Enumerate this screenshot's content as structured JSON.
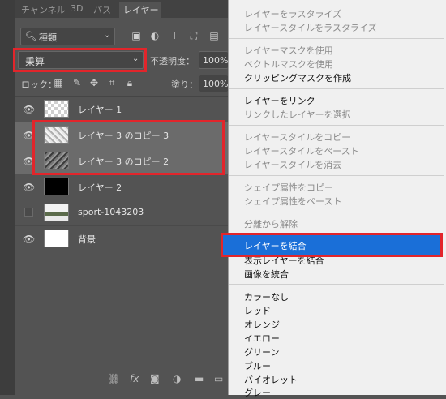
{
  "tabs": [
    "チャンネル",
    "3D",
    "パス",
    "レイヤー"
  ],
  "filter": {
    "label": "種類"
  },
  "blend_mode": "乗算",
  "opacity": {
    "label": "不透明度：",
    "value": "100%"
  },
  "lock": {
    "label": "ロック："
  },
  "fill": {
    "label": "塗り：",
    "value": "100%"
  },
  "layers": [
    {
      "name": "レイヤー 1",
      "visible": true
    },
    {
      "name": "レイヤー 3 のコピー 3",
      "visible": true,
      "selected": true
    },
    {
      "name": "レイヤー 3 のコピー 2",
      "visible": true,
      "selected": true
    },
    {
      "name": "レイヤー 2",
      "visible": true
    },
    {
      "name": "sport-1043203",
      "visible": false
    },
    {
      "name": "背景",
      "visible": true
    }
  ],
  "menu": {
    "items": [
      "レイヤーをラスタライズ",
      "レイヤースタイルをラスタライズ",
      "レイヤーマスクを使用",
      "ベクトルマスクを使用",
      "クリッピングマスクを作成",
      "レイヤーをリンク",
      "リンクしたレイヤーを選択",
      "レイヤースタイルをコピー",
      "レイヤースタイルをペースト",
      "レイヤースタイルを消去",
      "シェイプ属性をコピー",
      "シェイプ属性をペースト",
      "分離から解除",
      "レイヤーを結合",
      "表示レイヤーを結合",
      "画像を統合",
      "カラーなし",
      "レッド",
      "オレンジ",
      "イエロー",
      "グリーン",
      "ブルー",
      "バイオレット",
      "グレー"
    ]
  },
  "colors": {
    "highlight": "#1a6fd8",
    "annotation_red": "#e2252b"
  }
}
